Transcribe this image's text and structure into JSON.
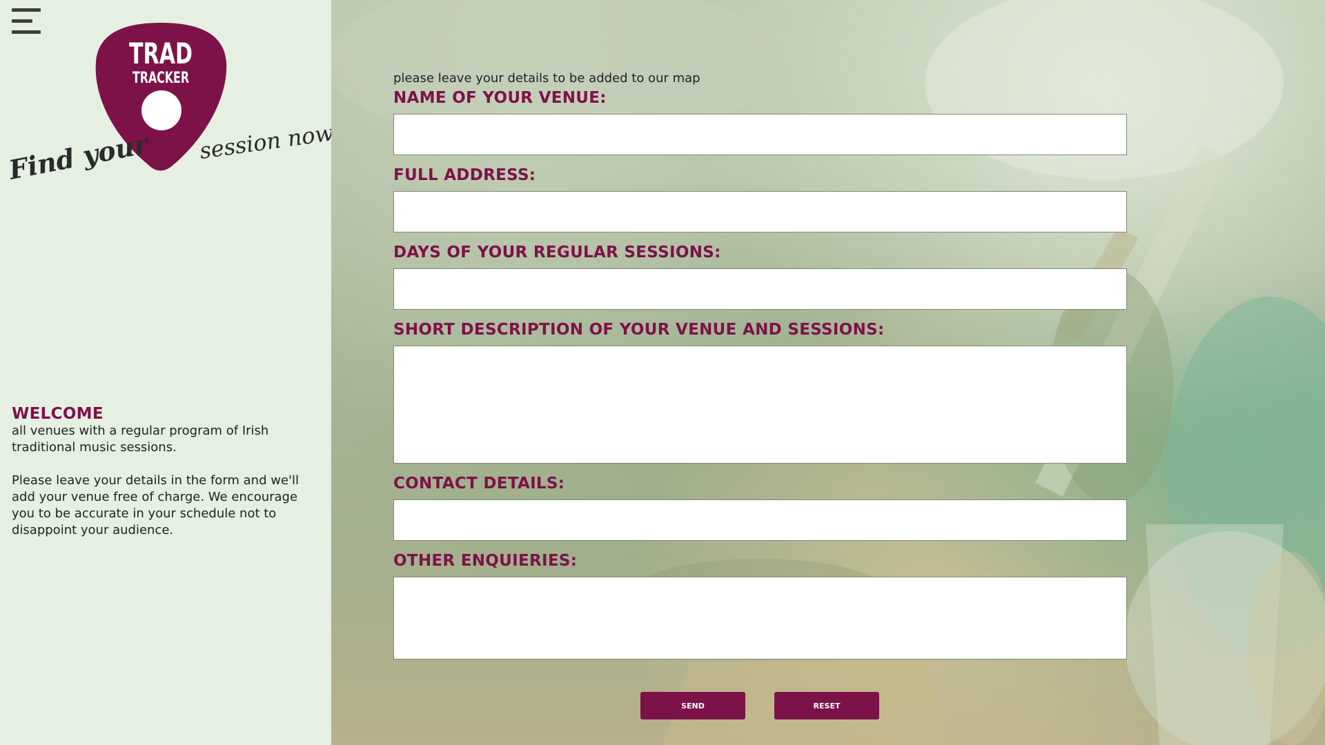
{
  "sidebar": {
    "menu_icon": "hamburger-menu-icon",
    "logo": {
      "line1": "TRAD",
      "line2": "TRACKER",
      "tagline_left": "Find your",
      "tagline_right": "session now"
    },
    "welcome": {
      "heading": "WELCOME",
      "paragraph1": "all venues with a regular program of Irish traditional music sessions.",
      "paragraph2": "Please leave your details in the form and we'll add your venue free of charge. We encourage you to be accurate in your schedule not to disappoint your audience."
    }
  },
  "form": {
    "intro": "please leave your details to be added to our map",
    "fields": {
      "venue_name": {
        "label": "NAME OF YOUR VENUE:",
        "value": ""
      },
      "address": {
        "label": "FULL ADDRESS:",
        "value": ""
      },
      "days": {
        "label": "DAYS OF YOUR REGULAR SESSIONS:",
        "value": ""
      },
      "description": {
        "label": "SHORT DESCRIPTION OF YOUR VENUE AND SESSIONS:",
        "value": ""
      },
      "contact": {
        "label": "CONTACT DETAILS:",
        "value": ""
      },
      "other": {
        "label": "OTHER ENQUIERIES:",
        "value": ""
      }
    },
    "buttons": {
      "send": "SEND",
      "reset": "RESET"
    }
  },
  "colors": {
    "accent": "#7d1248",
    "sidebar_bg": "#e5efe2",
    "text": "#222222"
  }
}
